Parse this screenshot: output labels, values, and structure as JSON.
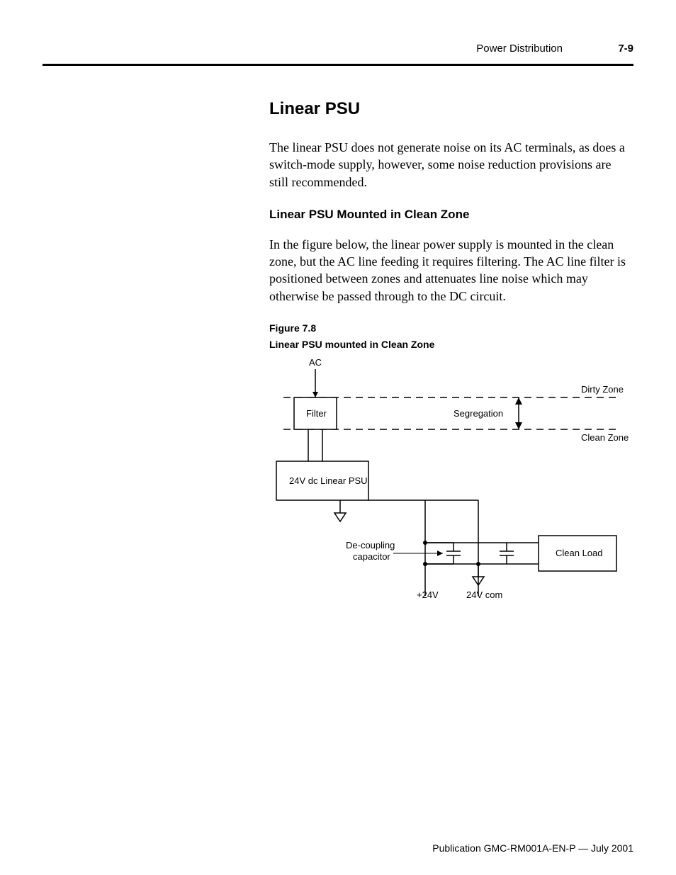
{
  "header": {
    "chapter": "Power Distribution",
    "page": "7-9"
  },
  "section": {
    "title": "Linear PSU",
    "intro": "The linear PSU does not generate noise on its AC terminals, as does a switch-mode supply, however, some noise reduction provisions are still recommended."
  },
  "subsection": {
    "title": "Linear PSU Mounted in Clean Zone",
    "body": "In the figure below, the linear power supply is mounted in the clean zone, but the AC line feeding it requires filtering. The AC line filter is positioned between zones and attenuates line noise which may otherwise be passed through to the DC circuit."
  },
  "figure": {
    "number": "Figure 7.8",
    "caption": "Linear PSU mounted in Clean Zone",
    "labels": {
      "ac": "AC",
      "filter": "Filter",
      "psu": "24V dc Linear PSU",
      "decoupling1": "De-coupling",
      "decoupling2": "capacitor",
      "segregation": "Segregation",
      "dirty": "Dirty Zone",
      "clean": "Clean Zone",
      "load": "Clean Load",
      "plus24": "+24V",
      "com": "24V com"
    }
  },
  "footer": {
    "pub": "Publication GMC-RM001A-EN-P — July 2001"
  }
}
